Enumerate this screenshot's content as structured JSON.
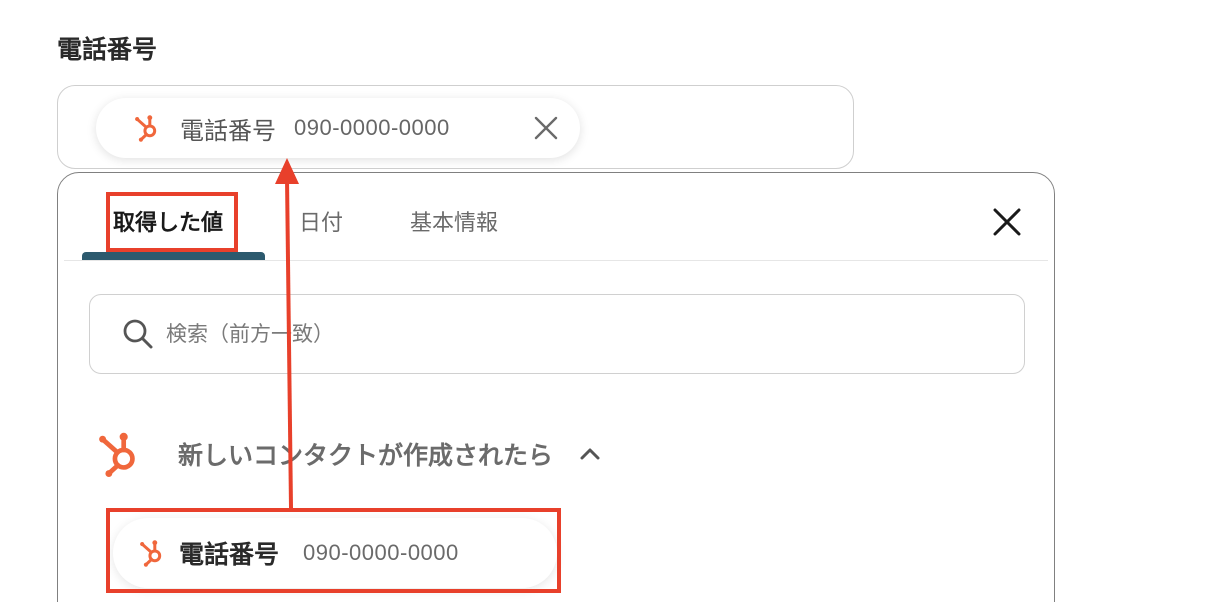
{
  "field": {
    "label": "電話番号"
  },
  "selected_chip": {
    "name": "電話番号",
    "value": "090-0000-0000",
    "icon": "hubspot-icon",
    "remove_icon": "close-icon"
  },
  "popup": {
    "tabs": [
      {
        "label": "取得した値",
        "active": true
      },
      {
        "label": "日付",
        "active": false
      },
      {
        "label": "基本情報",
        "active": false
      }
    ],
    "close_icon": "close-icon",
    "search": {
      "placeholder": "検索（前方一致）",
      "icon": "search-icon"
    },
    "section": {
      "title": "新しいコンタクトが作成されたら",
      "icon": "hubspot-icon",
      "expanded": true
    },
    "items": [
      {
        "name": "電話番号",
        "value": "090-0000-0000",
        "icon": "hubspot-icon"
      }
    ]
  },
  "colors": {
    "hubspot_orange": "#f0673c",
    "active_tab_underline": "#2c5a6e",
    "annotation_red": "#e8402b"
  }
}
